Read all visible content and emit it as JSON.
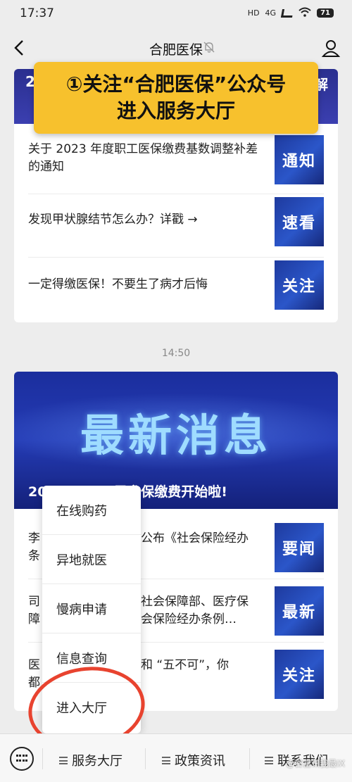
{
  "status": {
    "time": "17:37",
    "network": "4G",
    "hd": "HD",
    "battery": "71"
  },
  "nav": {
    "title": "合肥医保"
  },
  "overlay": {
    "line1": "①关注“合肥医保”公众号",
    "line2": "进入服务大厅"
  },
  "card1": {
    "banner_left": "2",
    "banner_right": "解",
    "items": [
      {
        "text": "关于 2023 年度职工医保缴费基数调整补差的通知",
        "thumb": "通知"
      },
      {
        "text": "发现甲状腺结节怎么办？详戳 →",
        "thumb": "速看"
      },
      {
        "text": "一定得缴医保！不要生了病才后悔",
        "thumb": "关注"
      }
    ]
  },
  "timestamp": "14:50",
  "card2": {
    "headline": "最新消息",
    "caption": "20 　　 　　 民参保缴费开始啦!",
    "items": [
      {
        "text_prefix": "李",
        "text_suffix": "公布《社会保险经办",
        "text_line2_prefix": "条",
        "thumb": "要闻"
      },
      {
        "text_prefix": "司",
        "text_suffix": "社会保障部、医疗保",
        "text_line2_prefix": "障",
        "text_line2_suffix": "会保险经办条例…",
        "thumb": "最新"
      },
      {
        "text_prefix": "医",
        "text_suffix": "和 “五不可”，你",
        "text_line2_prefix": "都",
        "thumb": "关注"
      }
    ]
  },
  "popup_menu": {
    "items": [
      "在线购药",
      "异地就医",
      "慢病申请",
      "信息查询",
      "进入大厅"
    ]
  },
  "bottom_bar": {
    "tabs": [
      "服务大厅",
      "政策资讯",
      "联系我们"
    ]
  },
  "watermark": "@日富讯我最IX"
}
